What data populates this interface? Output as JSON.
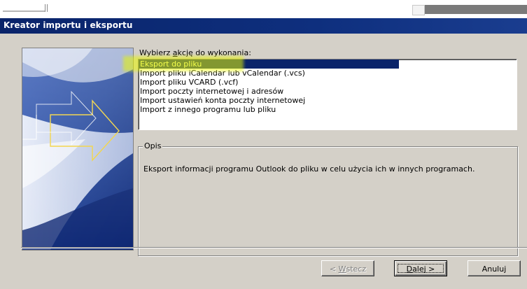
{
  "dialog": {
    "title": "Kreator importu i eksportu",
    "prompt_prefix": "Wybierz ",
    "prompt_underlined": "a",
    "prompt_suffix": "kcję do wykonania:",
    "actions": [
      "Eksport do pliku",
      "Import pliku iCalendar lub vCalendar (.vcs)",
      "Import pliku VCARD (.vcf)",
      "Import poczty internetowej i adresów",
      "Import ustawień konta poczty internetowej",
      "Import z innego programu lub pliku"
    ],
    "selected_index": 0,
    "description_label": "Opis",
    "description_text": "Eksport informacji programu Outlook do pliku w celu użycia ich w innych programach.",
    "buttons": {
      "back_prefix": "< ",
      "back_underlined": "W",
      "back_suffix": "stecz",
      "next_underlined": "D",
      "next_suffix": "alej >",
      "cancel": "Anuluj"
    }
  },
  "colors": {
    "title_bar": "#0a246a",
    "selection": "#0a246a",
    "dialog_face": "#d4d0c8",
    "highlight_marker": "#e8f600"
  }
}
